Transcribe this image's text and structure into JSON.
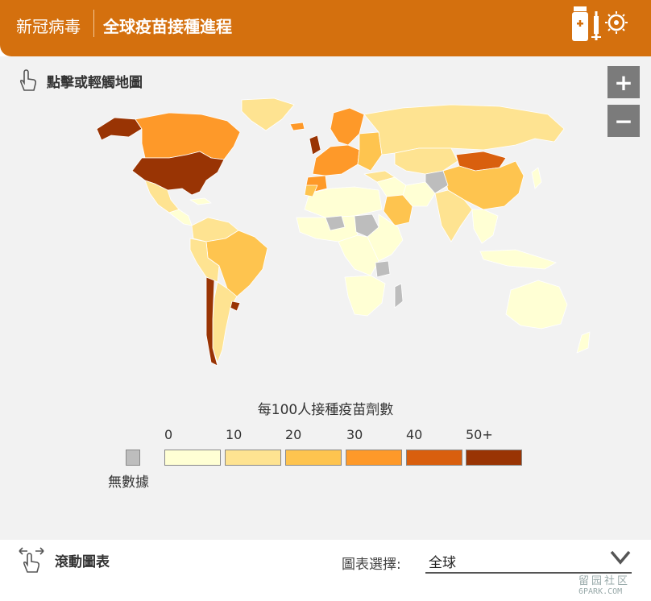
{
  "header": {
    "brand": "新冠病毒",
    "title": "全球疫苗接種進程"
  },
  "map": {
    "hint": "點擊或輕觸地圖",
    "zoom_in": "+",
    "zoom_out": "−",
    "colors": {
      "no_data": "#bdbdbd",
      "c0": "#ffffd4",
      "c10": "#fee391",
      "c20": "#fec44f",
      "c30": "#fe9929",
      "c40": "#d95f0e",
      "c50": "#993404",
      "ocean": "#f2f2f2",
      "border": "#ffffff"
    }
  },
  "legend": {
    "title": "每100人接種疫苗劑數",
    "ticks": [
      "0",
      "10",
      "20",
      "30",
      "40",
      "50+"
    ],
    "no_data_label": "無數據"
  },
  "footer": {
    "scroll_hint": "滾動圖表",
    "selector_label": "圖表選擇:",
    "selector_value": "全球"
  },
  "watermark": {
    "line1": "留园社区",
    "line2": "6PARK.COM"
  }
}
